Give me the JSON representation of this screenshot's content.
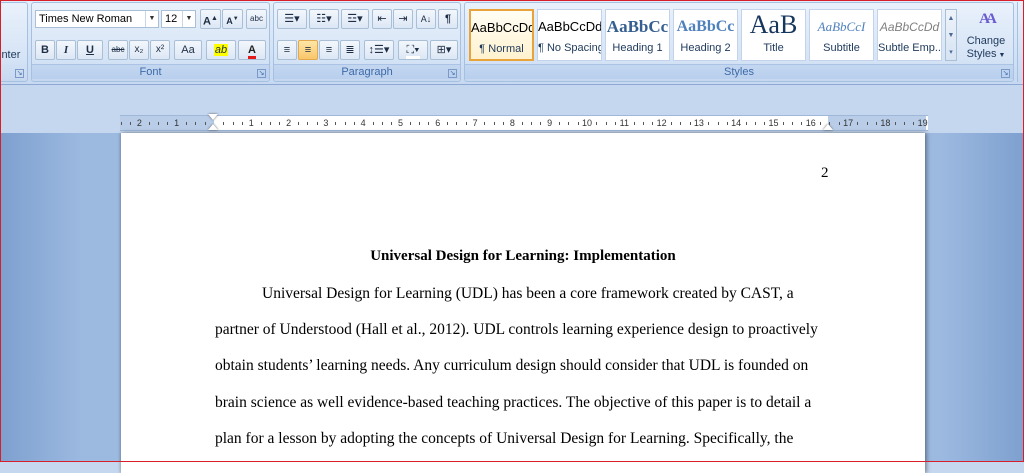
{
  "clipboard": {
    "format_painter_label": "inter"
  },
  "font": {
    "group_label": "Font",
    "font_name": "Times New Roman",
    "font_size": "12",
    "grow_label": "A",
    "shrink_label": "A",
    "clear_label": "abc",
    "bold": "B",
    "italic": "I",
    "underline": "U",
    "strike": "abc",
    "subscript": "x₂",
    "superscript": "x²",
    "change_case": "Aa",
    "highlight": "ab",
    "font_color": "A"
  },
  "paragraph": {
    "group_label": "Paragraph",
    "show_marks": "¶",
    "sort": "A↓"
  },
  "styles": {
    "group_label": "Styles",
    "items": [
      {
        "sample": "AaBbCcDd",
        "name": "¶ Normal"
      },
      {
        "sample": "AaBbCcDd",
        "name": "¶ No Spacing"
      },
      {
        "sample": "AaBbCc",
        "name": "Heading 1"
      },
      {
        "sample": "AaBbCc",
        "name": "Heading 2"
      },
      {
        "sample": "AaB",
        "name": "Title"
      },
      {
        "sample": "AaBbCcI",
        "name": "Subtitle"
      },
      {
        "sample": "AaBbCcDd",
        "name": "Subtle Emp..."
      }
    ],
    "change_styles_label_1": "Change",
    "change_styles_label_2": "Styles",
    "change_styles_icon": "AA"
  },
  "ruler": {
    "left_labels": [
      "2",
      "1"
    ],
    "labels": [
      "1",
      "2",
      "3",
      "4",
      "5",
      "6",
      "7",
      "8",
      "9",
      "10",
      "11",
      "12",
      "13",
      "14",
      "15",
      "16",
      "17",
      "18",
      "19"
    ]
  },
  "document": {
    "page_number": "2",
    "title": "Universal Design for Learning:  Implementation",
    "lines": [
      "Universal Design for Learning (UDL) has been a core framework created by CAST, a",
      "partner of Understood (Hall et al., 2012). UDL controls learning experience design to proactively",
      "obtain students’ learning needs. Any curriculum design should consider that UDL is founded on",
      "brain science as well evidence-based teaching practices. The objective of this paper is to detail a",
      "plan for a lesson by adopting the concepts of Universal Design for Learning. Specifically, the"
    ]
  }
}
